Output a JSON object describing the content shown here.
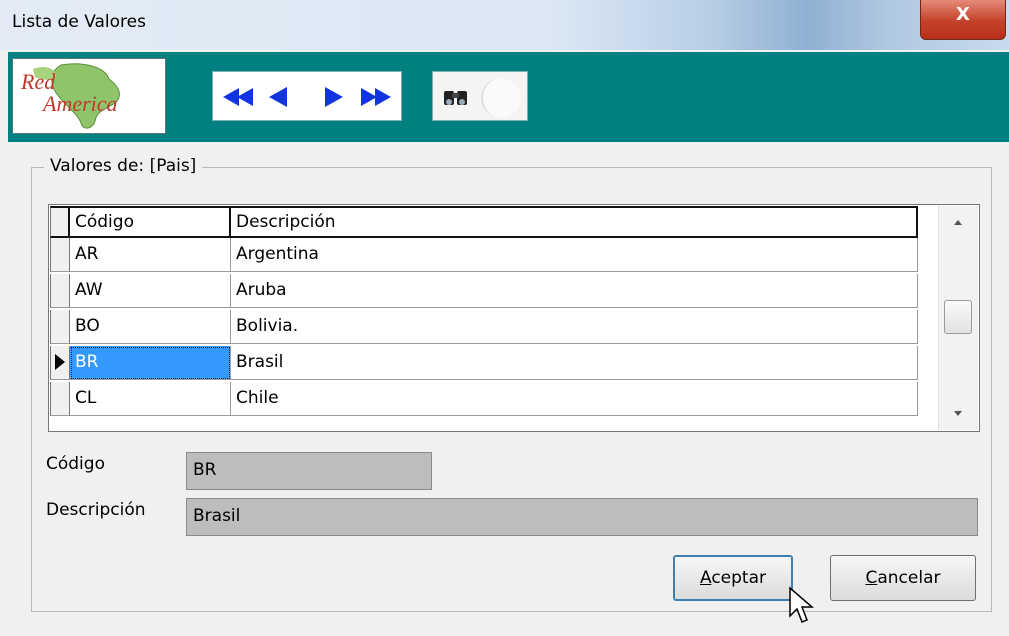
{
  "window": {
    "title": "Lista de Valores",
    "close_label": "X"
  },
  "toolbar": {
    "logo": {
      "line1": "Red",
      "line2": "America"
    },
    "nav_buttons": [
      "first-record",
      "previous-record",
      "next-record",
      "last-record"
    ],
    "search_icon": "binoculars-icon"
  },
  "group": {
    "legend": "Valores de: [Pais]"
  },
  "grid": {
    "columns": [
      "Código",
      "Descripción"
    ],
    "rows": [
      {
        "code": "AR",
        "desc": "Argentina"
      },
      {
        "code": "AW",
        "desc": "Aruba"
      },
      {
        "code": "BO",
        "desc": "Bolivia."
      },
      {
        "code": "BR",
        "desc": "Brasil"
      },
      {
        "code": "CL",
        "desc": "Chile"
      }
    ],
    "selected_index": 3
  },
  "fields": {
    "codigo_label": "Código",
    "codigo_value": "BR",
    "descripcion_label": "Descripción",
    "descripcion_value": "Brasil"
  },
  "buttons": {
    "aceptar_first": "A",
    "aceptar_rest": "ceptar",
    "cancelar_first": "C",
    "cancelar_rest": "ancelar"
  },
  "colors": {
    "toolbar_bg": "#008080",
    "selection": "#3399ff",
    "nav_arrows": "#1034e0"
  }
}
